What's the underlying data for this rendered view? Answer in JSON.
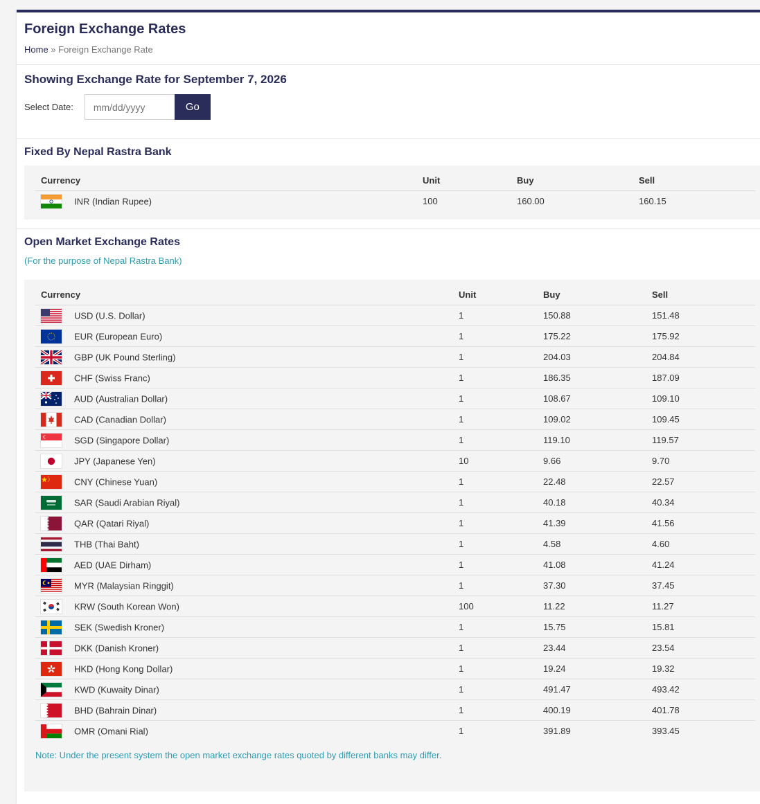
{
  "page_title": "Foreign Exchange Rates",
  "breadcrumb": {
    "home": "Home",
    "separator": "»",
    "current": "Foreign Exchange Rate"
  },
  "showing": "Showing Exchange Rate for September 7, 2026",
  "date_form": {
    "label": "Select Date:",
    "placeholder": "mm/dd/yyyy",
    "go_label": "Go"
  },
  "fixed": {
    "title": "Fixed By Nepal Rastra Bank",
    "headers": {
      "currency": "Currency",
      "unit": "Unit",
      "buy": "Buy",
      "sell": "Sell"
    },
    "rows": [
      {
        "flag": "in-flag-icon",
        "currency": "INR (Indian Rupee)",
        "unit": "100",
        "buy": "160.00",
        "sell": "160.15"
      }
    ]
  },
  "open_market": {
    "title": "Open Market Exchange Rates",
    "subtitle": "(For the purpose of Nepal Rastra Bank)",
    "headers": {
      "currency": "Currency",
      "unit": "Unit",
      "buy": "Buy",
      "sell": "Sell"
    },
    "rows": [
      {
        "flag": "us-flag-icon",
        "currency": "USD (U.S. Dollar)",
        "unit": "1",
        "buy": "150.88",
        "sell": "151.48"
      },
      {
        "flag": "eu-flag-icon",
        "currency": "EUR (European Euro)",
        "unit": "1",
        "buy": "175.22",
        "sell": "175.92"
      },
      {
        "flag": "gb-flag-icon",
        "currency": "GBP (UK Pound Sterling)",
        "unit": "1",
        "buy": "204.03",
        "sell": "204.84"
      },
      {
        "flag": "ch-flag-icon",
        "currency": "CHF (Swiss Franc)",
        "unit": "1",
        "buy": "186.35",
        "sell": "187.09"
      },
      {
        "flag": "au-flag-icon",
        "currency": "AUD (Australian Dollar)",
        "unit": "1",
        "buy": "108.67",
        "sell": "109.10"
      },
      {
        "flag": "ca-flag-icon",
        "currency": "CAD (Canadian Dollar)",
        "unit": "1",
        "buy": "109.02",
        "sell": "109.45"
      },
      {
        "flag": "sg-flag-icon",
        "currency": "SGD (Singapore Dollar)",
        "unit": "1",
        "buy": "119.10",
        "sell": "119.57"
      },
      {
        "flag": "jp-flag-icon",
        "currency": "JPY (Japanese Yen)",
        "unit": "10",
        "buy": "9.66",
        "sell": "9.70"
      },
      {
        "flag": "cn-flag-icon",
        "currency": "CNY (Chinese Yuan)",
        "unit": "1",
        "buy": "22.48",
        "sell": "22.57"
      },
      {
        "flag": "sa-flag-icon",
        "currency": "SAR (Saudi Arabian Riyal)",
        "unit": "1",
        "buy": "40.18",
        "sell": "40.34"
      },
      {
        "flag": "qa-flag-icon",
        "currency": "QAR (Qatari Riyal)",
        "unit": "1",
        "buy": "41.39",
        "sell": "41.56"
      },
      {
        "flag": "th-flag-icon",
        "currency": "THB (Thai Baht)",
        "unit": "1",
        "buy": "4.58",
        "sell": "4.60"
      },
      {
        "flag": "ae-flag-icon",
        "currency": "AED (UAE Dirham)",
        "unit": "1",
        "buy": "41.08",
        "sell": "41.24"
      },
      {
        "flag": "my-flag-icon",
        "currency": "MYR (Malaysian Ringgit)",
        "unit": "1",
        "buy": "37.30",
        "sell": "37.45"
      },
      {
        "flag": "kr-flag-icon",
        "currency": "KRW (South Korean Won)",
        "unit": "100",
        "buy": "11.22",
        "sell": "11.27"
      },
      {
        "flag": "se-flag-icon",
        "currency": "SEK (Swedish Kroner)",
        "unit": "1",
        "buy": "15.75",
        "sell": "15.81"
      },
      {
        "flag": "dk-flag-icon",
        "currency": "DKK (Danish Kroner)",
        "unit": "1",
        "buy": "23.44",
        "sell": "23.54"
      },
      {
        "flag": "hk-flag-icon",
        "currency": "HKD (Hong Kong Dollar)",
        "unit": "1",
        "buy": "19.24",
        "sell": "19.32"
      },
      {
        "flag": "kw-flag-icon",
        "currency": "KWD (Kuwaity Dinar)",
        "unit": "1",
        "buy": "491.47",
        "sell": "493.42"
      },
      {
        "flag": "bh-flag-icon",
        "currency": "BHD (Bahrain Dinar)",
        "unit": "1",
        "buy": "400.19",
        "sell": "401.78"
      },
      {
        "flag": "om-flag-icon",
        "currency": "OMR (Omani Rial)",
        "unit": "1",
        "buy": "391.89",
        "sell": "393.45"
      }
    ],
    "note": "Note: Under the present system the open market exchange rates quoted by different banks may differ."
  },
  "colors": {
    "primary": "#2a2d5a",
    "accent": "#2a9db3",
    "panel": "#f4f4f4"
  }
}
